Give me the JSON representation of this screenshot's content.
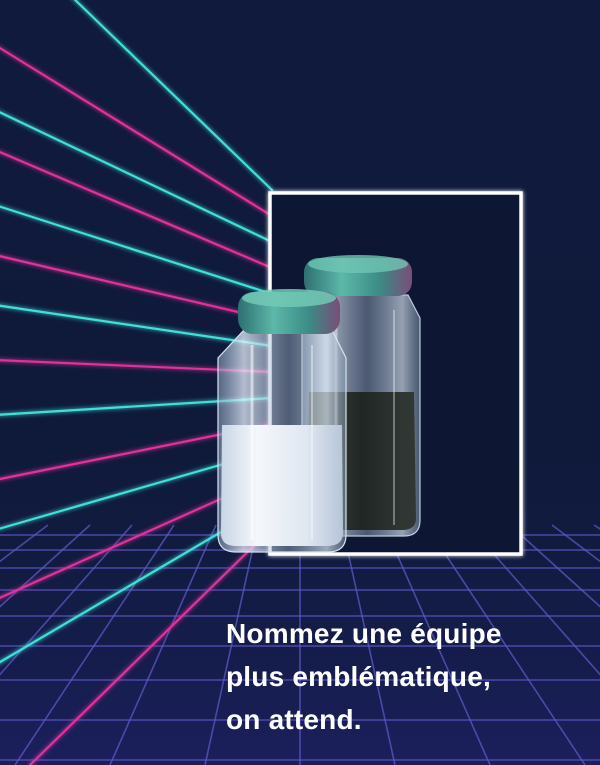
{
  "caption": {
    "lines": [
      "Nommez une équipe",
      "plus emblématique,",
      "on attend."
    ]
  },
  "colors": {
    "background": "#0f1a3b",
    "beam_cyan": "#3fe0d8",
    "beam_magenta": "#e0309a",
    "grid": "#6b62d8",
    "frame": "#ffffff",
    "text": "#ffffff"
  }
}
